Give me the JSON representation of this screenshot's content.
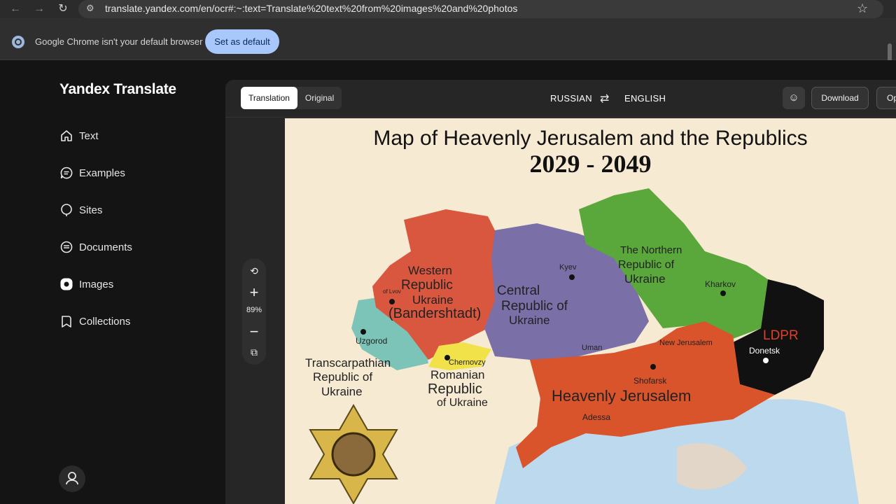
{
  "browser": {
    "url": "translate.yandex.com/en/ocr#:~:text=Translate%20text%20from%20images%20and%20photos",
    "infobar_text": "Google Chrome isn't your default browser",
    "set_default_label": "Set as default"
  },
  "app": {
    "brand": "Yandex Translate",
    "nav": [
      {
        "label": "Text",
        "icon": "home-icon"
      },
      {
        "label": "Examples",
        "icon": "chat-icon"
      },
      {
        "label": "Sites",
        "icon": "globe-icon"
      },
      {
        "label": "Documents",
        "icon": "document-icon"
      },
      {
        "label": "Images",
        "icon": "camera-icon"
      },
      {
        "label": "Collections",
        "icon": "bookmark-icon"
      }
    ]
  },
  "toolbar": {
    "tab_translation": "Translation",
    "tab_original": "Original",
    "source_lang": "RUSSIAN",
    "target_lang": "ENGLISH",
    "download_label": "Download",
    "options_label": "Op"
  },
  "zoom": {
    "level": "89%"
  },
  "map": {
    "title": "Map of Heavenly Jerusalem and the Republics",
    "years": "2029 - 2049",
    "regions": {
      "western": [
        "Western",
        "Republic",
        "Ukraine",
        "(Bandershtadt)"
      ],
      "central": [
        "Central",
        "Republic of",
        "Ukraine"
      ],
      "northern": [
        "The Northern",
        "Republic of",
        "Ukraine"
      ],
      "ldpr": "LDPR",
      "transcarpathian": [
        "Transcarpathian",
        "Republic of",
        "Ukraine"
      ],
      "romanian": [
        "Romanian",
        "Republic",
        "of Ukraine"
      ],
      "heavenly": "Heavenly Jerusalem"
    },
    "cities": {
      "kyev": "Kyev",
      "kharkov": "Kharkov",
      "lvov": "of Lvov",
      "uzgorod": "Uzgorod",
      "chernovzy": "Chernovzy",
      "uman": "Uman",
      "new_jerusalem": "New Jerusalem",
      "donetsk": "Donetsk",
      "shofarsk": "Shofarsk",
      "adessa": "Adessa"
    },
    "colors": {
      "background": "#f7ead2",
      "western": "#d9573f",
      "central": "#7b6fa8",
      "northern": "#5aa83c",
      "ldpr": "#111111",
      "heavenly": "#d9532b",
      "transcarpathian": "#7cc4b8",
      "romanian": "#f2e24a",
      "sea": "#bcd9ee"
    }
  }
}
